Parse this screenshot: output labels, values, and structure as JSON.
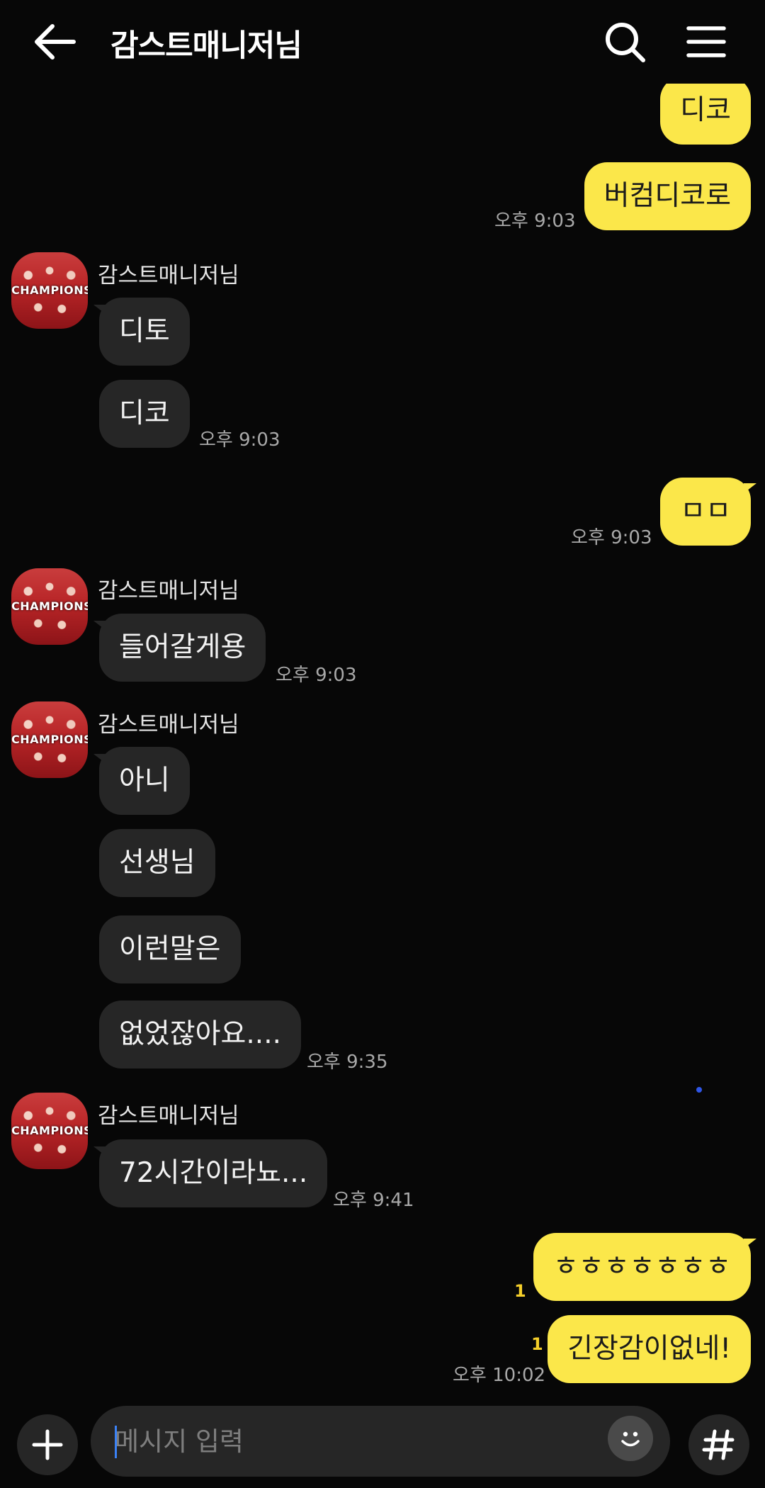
{
  "header": {
    "title": "감스트매니저님",
    "back_icon": "arrow-left-icon",
    "search_icon": "search-icon",
    "menu_icon": "hamburger-menu-icon"
  },
  "messages": [
    {
      "direction": "out",
      "text": "디코"
    },
    {
      "direction": "out",
      "text": "버컴디코로",
      "time": "오후 9:03"
    },
    {
      "direction": "in",
      "sender": "감스트매니저님",
      "text": "디토"
    },
    {
      "direction": "in",
      "text": "디코",
      "time": "오후 9:03"
    },
    {
      "direction": "out",
      "text": "ㅁㅁ",
      "time": "오후 9:03"
    },
    {
      "direction": "in",
      "sender": "감스트매니저님",
      "text": "들어갈게용",
      "time": "오후 9:03"
    },
    {
      "direction": "in",
      "sender": "감스트매니저님",
      "text": "아니"
    },
    {
      "direction": "in",
      "text": "선생님"
    },
    {
      "direction": "in",
      "text": "이런말은"
    },
    {
      "direction": "in",
      "text": "없었잖아요....",
      "time": "오후 9:35"
    },
    {
      "direction": "in",
      "sender": "감스트매니저님",
      "text": "72시간이라뇨...",
      "time": "오후 9:41"
    },
    {
      "direction": "out",
      "text": "ㅎㅎㅎㅎㅎㅎㅎ",
      "unread": "1"
    },
    {
      "direction": "out",
      "text": "긴장감이없네!",
      "unread": "1",
      "time": "오후 10:02"
    }
  ],
  "avatar_text": "CHAMPIONS",
  "input": {
    "placeholder": "메시지 입력",
    "plus_icon": "plus-icon",
    "emoji_icon": "emoji-icon",
    "hash_icon": "hash-icon"
  },
  "colors": {
    "background": "#070707",
    "outgoing_bubble": "#fbe74a",
    "incoming_bubble": "#262626",
    "unread_count": "#f5cf2a"
  }
}
